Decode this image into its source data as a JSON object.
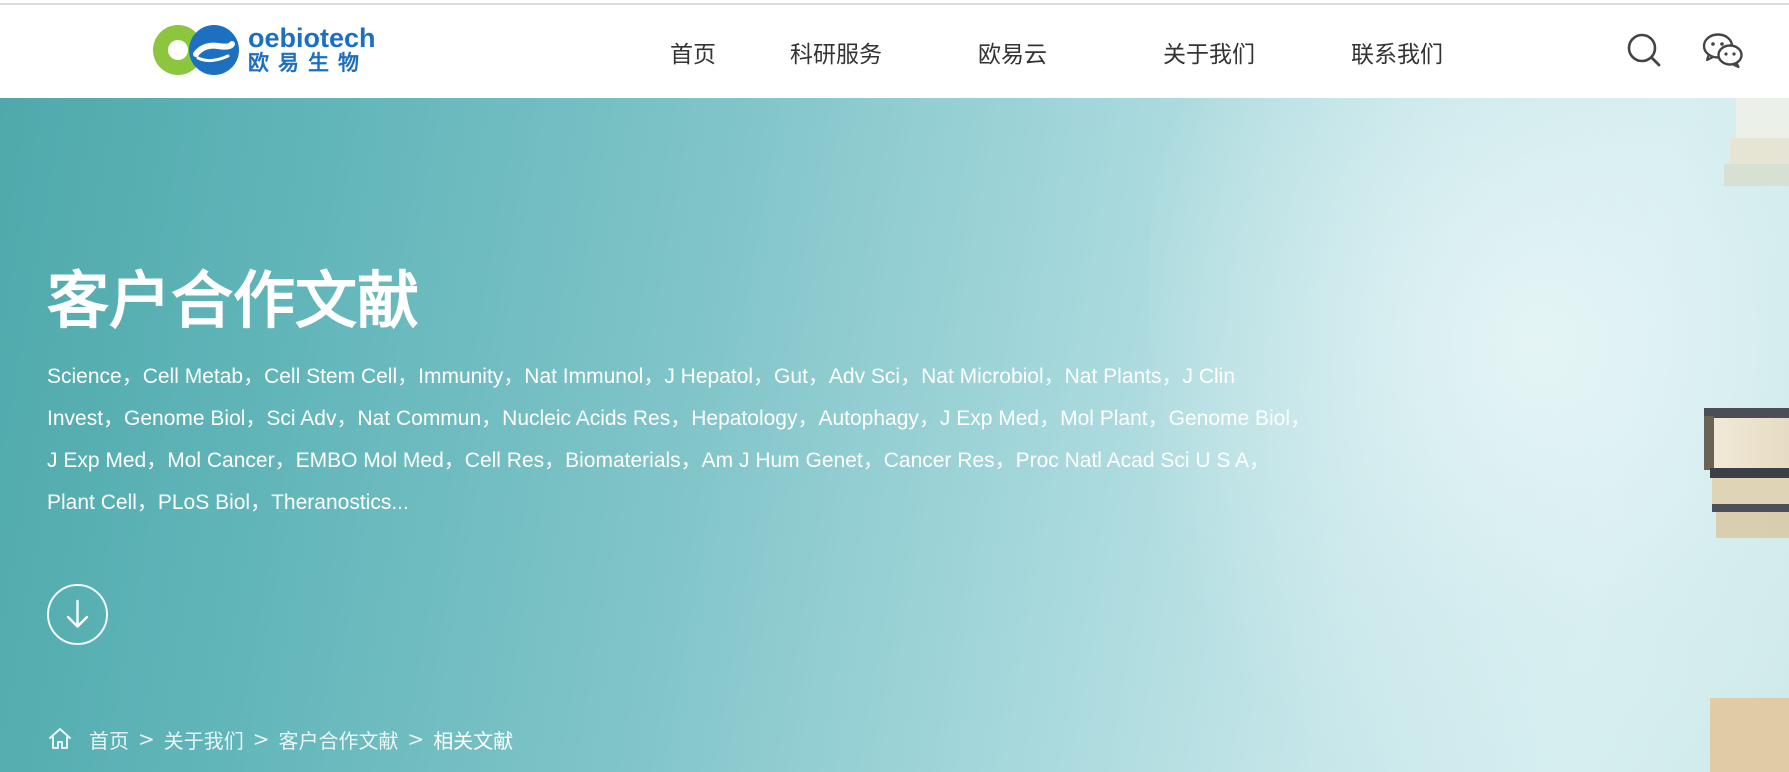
{
  "header": {
    "logo_en": "oebiotech",
    "logo_cn": "欧易生物",
    "nav": [
      {
        "label": "首页"
      },
      {
        "label": "科研服务"
      },
      {
        "label": "欧易云"
      },
      {
        "label": "关于我们"
      },
      {
        "label": "联系我们"
      }
    ],
    "icons": {
      "search": "search-icon",
      "wechat": "wechat-icon"
    }
  },
  "hero": {
    "title": "客户合作文献",
    "journals": "Science，Cell Metab，Cell Stem Cell，Immunity，Nat Immunol，J Hepatol，Gut，Adv Sci，Nat Microbiol，Nat Plants，J Clin Invest，Genome Biol，Sci Adv，Nat Commun，Nucleic Acids Res，Hepatology，Autophagy，J Exp Med，Mol Plant，Genome Biol，J Exp Med，Mol Cancer，EMBO Mol Med，Cell Res，Biomaterials，Am J Hum Genet，Cancer Res，Proc Natl Acad Sci U S A，Plant Cell，PLoS Biol，Theranostics...",
    "scroll_icon": "arrow-down-circle-icon"
  },
  "breadcrumb": {
    "home_icon": "home-icon",
    "separator": ">",
    "items": [
      "首页",
      "关于我们",
      "客户合作文献"
    ],
    "current": "相关文献"
  },
  "colors": {
    "brand_blue": "#1d6fc0",
    "brand_green": "#8cc63f",
    "nav_text": "#333333",
    "hero_left": "#4fa9ab",
    "hero_right": "#d5eef0"
  }
}
